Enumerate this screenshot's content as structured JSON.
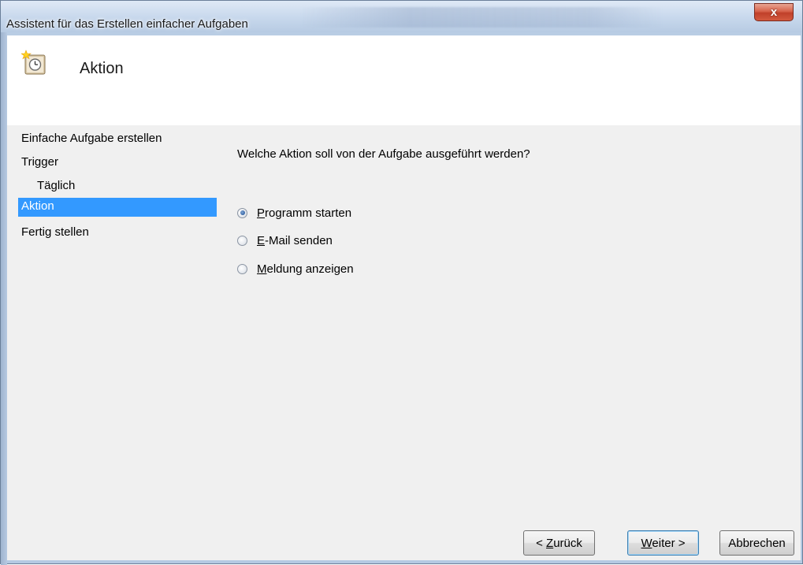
{
  "window": {
    "title": "Assistent für das Erstellen einfacher Aufgaben",
    "close_label": "x"
  },
  "header": {
    "icon": "task-scheduler-clock-icon",
    "title": "Aktion"
  },
  "nav": {
    "items": [
      {
        "label": "Einfache Aufgabe erstellen",
        "level": 0,
        "selected": false
      },
      {
        "label": "Trigger",
        "level": 0,
        "selected": false
      },
      {
        "label": "Täglich",
        "level": 1,
        "selected": false
      },
      {
        "label": "Aktion",
        "level": 0,
        "selected": true
      },
      {
        "label": "Fertig stellen",
        "level": 0,
        "selected": false
      }
    ]
  },
  "main": {
    "question": "Welche Aktion soll von der Aufgabe ausgeführt werden?",
    "options": [
      {
        "mnemonic": "P",
        "rest": "rogramm starten",
        "checked": true
      },
      {
        "mnemonic": "E",
        "rest": "-Mail senden",
        "checked": false
      },
      {
        "mnemonic": "M",
        "rest": "eldung anzeigen",
        "checked": false
      }
    ]
  },
  "buttons": {
    "back_prefix": "< ",
    "back_mnemonic": "Z",
    "back_rest": "urück",
    "next_mnemonic": "W",
    "next_rest": "eiter >",
    "cancel": "Abbrechen"
  }
}
